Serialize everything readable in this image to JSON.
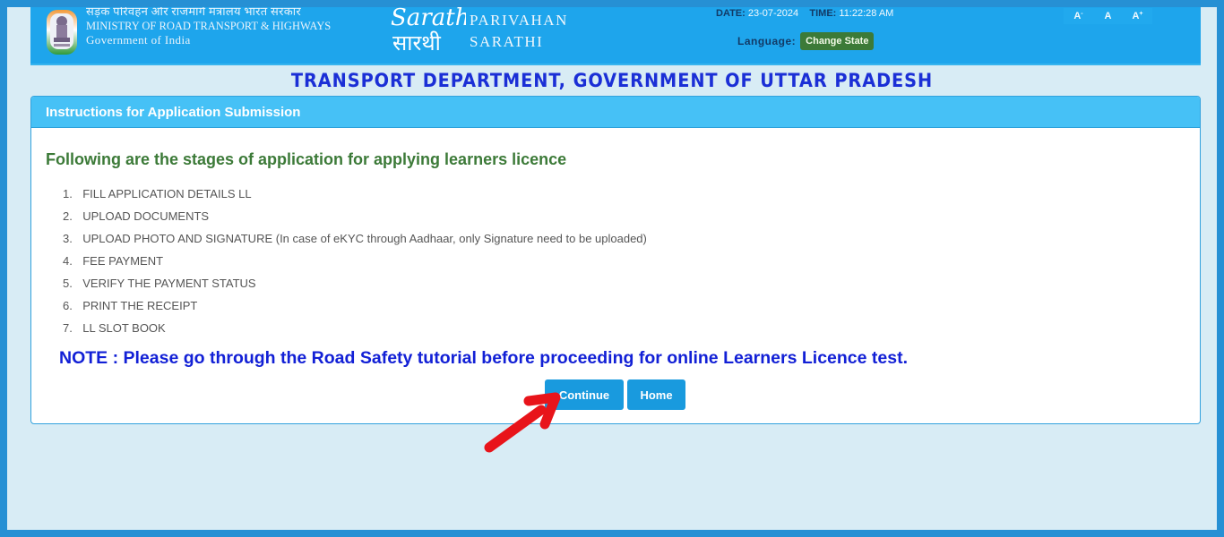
{
  "header": {
    "ministry_hindi": "सड़क परिवहन और राजमार्ग मंत्रालय भारत सरकार",
    "ministry_english": "MINISTRY OF ROAD TRANSPORT & HIGHWAYS",
    "government": "Government of India",
    "brand_line1": "PARIVAHAN",
    "brand_line2": "SARATHI",
    "date_label": "DATE:",
    "date_value": "23-07-2024",
    "time_label": "TIME:",
    "time_value": "11:22:28 AM",
    "language_label": "Language:",
    "change_state_label": "Change State",
    "font_controls": [
      {
        "label": "A",
        "sup": "-"
      },
      {
        "label": "A",
        "sup": ""
      },
      {
        "label": "A",
        "sup": "+"
      }
    ]
  },
  "department_title": "TRANSPORT DEPARTMENT, GOVERNMENT OF UTTAR PRADESH",
  "panel": {
    "heading": "Instructions for Application Submission",
    "stages_title": "Following are the stages of application for applying learners licence",
    "stages": [
      {
        "num": "1.",
        "text": "FILL APPLICATION DETAILS LL"
      },
      {
        "num": "2.",
        "text": "UPLOAD DOCUMENTS"
      },
      {
        "num": "3.",
        "text": "UPLOAD PHOTO AND SIGNATURE (In case of eKYC through Aadhaar, only Signature need to be uploaded)"
      },
      {
        "num": "4.",
        "text": "FEE PAYMENT"
      },
      {
        "num": "5.",
        "text": "VERIFY THE PAYMENT STATUS"
      },
      {
        "num": "6.",
        "text": "PRINT THE RECEIPT"
      },
      {
        "num": "7.",
        "text": "LL SLOT BOOK"
      }
    ],
    "note": "NOTE : Please go through the Road Safety tutorial before proceeding for online Learners Licence test.",
    "continue_label": "Continue",
    "home_label": "Home"
  },
  "colors": {
    "header_bg": "#1ea5ec",
    "panel_heading_bg": "#46c1f6",
    "title_blue": "#1b2fd6",
    "stages_green": "#3c7a38",
    "button_blue": "#199ade",
    "annotation_arrow": "#e8141a"
  }
}
